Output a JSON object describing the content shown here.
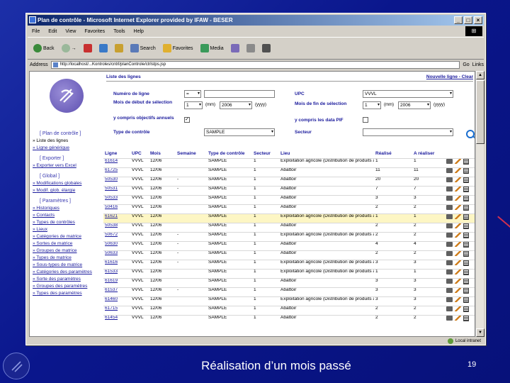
{
  "window": {
    "title": "Plan de contrôle - Microsoft Internet Explorer provided by IFAW - BESER",
    "btn_min": "_",
    "btn_max": "□",
    "btn_close": "×"
  },
  "menu": [
    "File",
    "Edit",
    "View",
    "Favorites",
    "Tools",
    "Help"
  ],
  "toolbar": {
    "back": "Back",
    "forward": "→",
    "stop": "",
    "refresh": "",
    "home": "",
    "search": "Search",
    "favorites": "Favorites",
    "media": "Media"
  },
  "address": {
    "label": "Address",
    "url": "http://localhost/...Kontroles/cntrl/planControle/ctrlstps.jsp",
    "go": "Go",
    "links": "Links"
  },
  "status": {
    "zone": "Local intranet"
  },
  "nav": {
    "sections": [
      {
        "title": "[ Plan de contrôle ]",
        "items": [
          {
            "label": "Liste des lignes",
            "plain": true
          },
          {
            "label": "Ligne générique",
            "plain": false
          }
        ]
      },
      {
        "title": "[ Exporter ]",
        "items": [
          {
            "label": "Exporter vers Excel",
            "plain": false
          }
        ]
      },
      {
        "title": "[ Global ]",
        "items": [
          {
            "label": "Modifications globales",
            "plain": false
          },
          {
            "label": "Modif. glob. élargie",
            "plain": false
          }
        ]
      },
      {
        "title": "[ Paramètres ]",
        "items": [
          {
            "label": "Historiques",
            "plain": false
          },
          {
            "label": "Contacts",
            "plain": false
          },
          {
            "label": "Types de contrôles",
            "plain": false
          },
          {
            "label": "Lieux",
            "plain": false
          },
          {
            "label": "Catégories de matrice",
            "plain": false
          },
          {
            "label": "Sortes de matrice",
            "plain": false
          },
          {
            "label": "Groupes de matrice",
            "plain": false
          },
          {
            "label": "Types de matrice",
            "plain": false
          },
          {
            "label": "Sous-types de matrice",
            "plain": false
          },
          {
            "label": "Catégories des paramètres",
            "plain": false
          },
          {
            "label": "Sorte des paramètres",
            "plain": false
          },
          {
            "label": "Groupes des paramètres",
            "plain": false
          },
          {
            "label": "Types des paramètres",
            "plain": false
          }
        ]
      }
    ]
  },
  "main": {
    "heading": "Liste des lignes",
    "top_right": "Nouvelle ligne - Clear",
    "form": {
      "numero_label": "Numéro de ligne",
      "numero_op": "=",
      "numero_value": "",
      "upc_label": "UPC",
      "upc_value": "VVVL",
      "mois_debut_label": "Mois de début de sélection",
      "mois_debut_month": "1",
      "mois_debut_unit": "(mm)",
      "mois_debut_year": "2006",
      "mois_debut_year_unit": "(yyyy)",
      "mois_fin_label": "Mois de fin de sélection",
      "mois_fin_month": "1",
      "mois_fin_unit": "(mm)",
      "mois_fin_year": "2006",
      "mois_fin_year_unit": "(yyyy)",
      "objectifs_label": "y compris objectifs annuels",
      "objectifs_checked": "✓",
      "pif_label": "y compris les data PIF",
      "type_label": "Type de contrôle",
      "type_value": "SAMPLE",
      "secteur_label": "Secteur",
      "secteur_value": ""
    },
    "columns": [
      "Ligne",
      "UPC",
      "Mois",
      "Semaine",
      "Type de contrôle",
      "Secteur",
      "Lieu",
      "Réalisé",
      "A réaliser",
      ""
    ],
    "rows": [
      {
        "ligne": "61614",
        "upc": "VVVL",
        "mois": "12/06",
        "semaine": "",
        "type": "SAMPLE",
        "secteur": "1",
        "lieu": "Exploitation agricole (Distribution de produits animaux et végétaux)",
        "realise": "1",
        "a_realiser": "1",
        "hl": false
      },
      {
        "ligne": "61725",
        "upc": "VVVL",
        "mois": "12/06",
        "semaine": "",
        "type": "SAMPLE",
        "secteur": "1",
        "lieu": "Abattoir",
        "realise": "11",
        "a_realiser": "11",
        "hl": false
      },
      {
        "ligne": "50530",
        "upc": "VVVL",
        "mois": "12/06",
        "semaine": "-",
        "type": "SAMPLE",
        "secteur": "1",
        "lieu": "Abattoir",
        "realise": "20",
        "a_realiser": "20",
        "hl": false
      },
      {
        "ligne": "50531",
        "upc": "VVVL",
        "mois": "12/06",
        "semaine": "-",
        "type": "SAMPLE",
        "secteur": "1",
        "lieu": "Abattoir",
        "realise": "7",
        "a_realiser": "7",
        "hl": false
      },
      {
        "ligne": "50533",
        "upc": "VVVL",
        "mois": "12/06",
        "semaine": "",
        "type": "SAMPLE",
        "secteur": "1",
        "lieu": "Abattoir",
        "realise": "3",
        "a_realiser": "3",
        "hl": false
      },
      {
        "ligne": "50416",
        "upc": "VVVL",
        "mois": "12/06",
        "semaine": "",
        "type": "SAMPLE",
        "secteur": "1",
        "lieu": "Abattoir",
        "realise": "2",
        "a_realiser": "2",
        "hl": false
      },
      {
        "ligne": "61621",
        "upc": "VVVL",
        "mois": "12/06",
        "semaine": "",
        "type": "SAMPLE",
        "secteur": "1",
        "lieu": "Exploitation agricole (Distribution de produits animaux et végétaux)",
        "realise": "1",
        "a_realiser": "1",
        "hl": true
      },
      {
        "ligne": "50538",
        "upc": "VVVL",
        "mois": "12/06",
        "semaine": "",
        "type": "SAMPLE",
        "secteur": "1",
        "lieu": "Abattoir",
        "realise": "2",
        "a_realiser": "2",
        "hl": false
      },
      {
        "ligne": "50672",
        "upc": "VVVL",
        "mois": "12/06",
        "semaine": "-",
        "type": "SAMPLE",
        "secteur": "1",
        "lieu": "Exploitation agricole (Distribution de produits animaux et végétaux)",
        "realise": "2",
        "a_realiser": "2",
        "hl": false
      },
      {
        "ligne": "50630",
        "upc": "VVVL",
        "mois": "12/06",
        "semaine": "-",
        "type": "SAMPLE",
        "secteur": "1",
        "lieu": "Abattoir",
        "realise": "4",
        "a_realiser": "4",
        "hl": false
      },
      {
        "ligne": "50633",
        "upc": "VVVL",
        "mois": "12/06",
        "semaine": "-",
        "type": "SAMPLE",
        "secteur": "1",
        "lieu": "Abattoir",
        "realise": "2",
        "a_realiser": "2",
        "hl": false
      },
      {
        "ligne": "61616",
        "upc": "VVVL",
        "mois": "12/06",
        "semaine": "-",
        "type": "SAMPLE",
        "secteur": "1",
        "lieu": "Exploitation agricole (Distribution de produits animaux et végétaux)",
        "realise": "3",
        "a_realiser": "3",
        "hl": false
      },
      {
        "ligne": "61533",
        "upc": "VVVL",
        "mois": "12/06",
        "semaine": "",
        "type": "SAMPLE",
        "secteur": "1",
        "lieu": "Exploitation agricole (Distribution de produits animaux et végétaux)",
        "realise": "1",
        "a_realiser": "1",
        "hl": false
      },
      {
        "ligne": "61619",
        "upc": "VVVL",
        "mois": "12/06",
        "semaine": "",
        "type": "SAMPLE",
        "secteur": "1",
        "lieu": "Abattoir",
        "realise": "3",
        "a_realiser": "3",
        "hl": false
      },
      {
        "ligne": "61537",
        "upc": "VVVL",
        "mois": "12/06",
        "semaine": "-",
        "type": "SAMPLE",
        "secteur": "1",
        "lieu": "Abattoir",
        "realise": "3",
        "a_realiser": "3",
        "hl": false
      },
      {
        "ligne": "61460",
        "upc": "VVVL",
        "mois": "12/06",
        "semaine": "",
        "type": "SAMPLE",
        "secteur": "1",
        "lieu": "Exploitation agricole (Distribution de produits animaux et végétaux)",
        "realise": "3",
        "a_realiser": "3",
        "hl": false
      },
      {
        "ligne": "61715",
        "upc": "VVVL",
        "mois": "12/06",
        "semaine": "",
        "type": "SAMPLE",
        "secteur": "1",
        "lieu": "Abattoir",
        "realise": "2",
        "a_realiser": "2",
        "hl": false
      },
      {
        "ligne": "61454",
        "upc": "VVVL",
        "mois": "12/06",
        "semaine": "",
        "type": "SAMPLE",
        "secteur": "1",
        "lieu": "Abattoir",
        "realise": "2",
        "a_realiser": "2",
        "hl": false
      }
    ]
  },
  "slide": {
    "caption": "Réalisation d’un mois passé",
    "number": "19"
  },
  "colors": {
    "slide_background": "#0a168c",
    "link": "#1a1a9c",
    "highlight_row": "#fdf6c4",
    "titlebar": "#0a246a"
  }
}
